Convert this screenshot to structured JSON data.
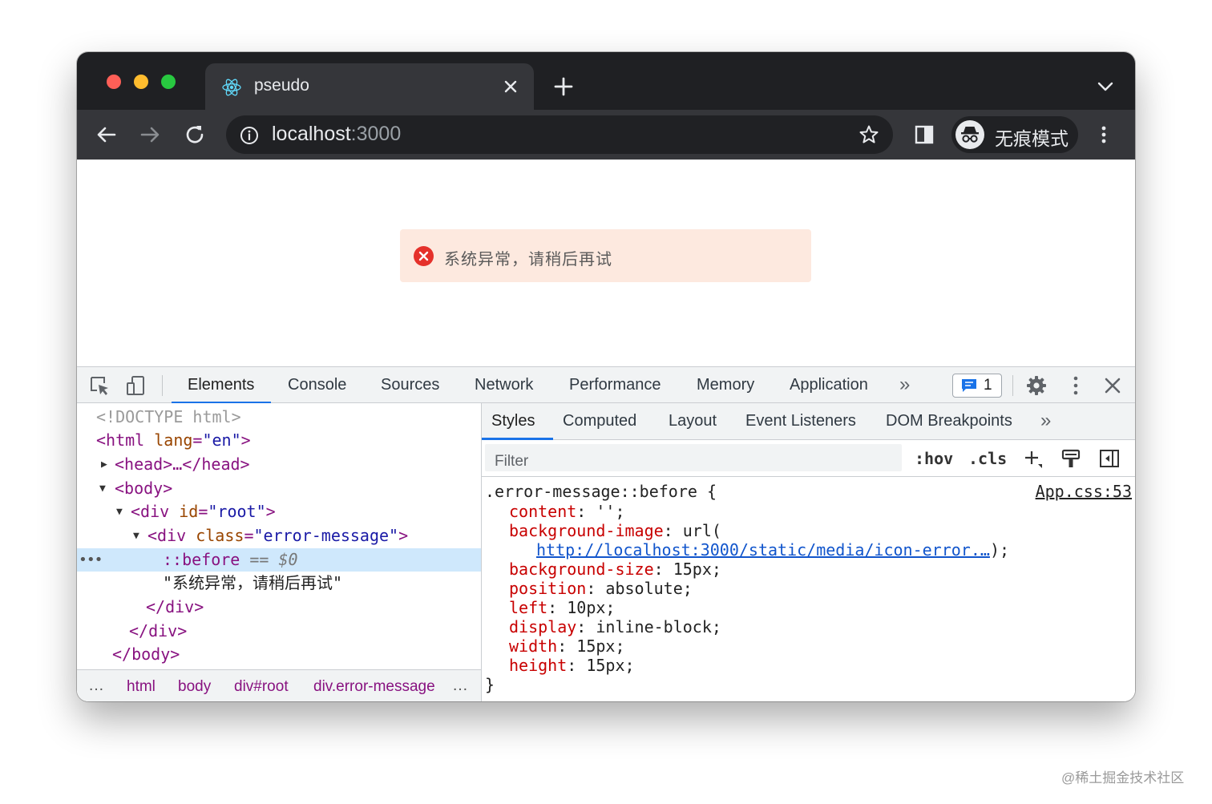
{
  "browser": {
    "tab_title": "pseudo",
    "url_host": "localhost",
    "url_port": ":3000",
    "incognito_label": "无痕模式"
  },
  "page": {
    "error_message": "系统异常，请稍后再试"
  },
  "devtools": {
    "tabs": [
      "Elements",
      "Console",
      "Sources",
      "Network",
      "Performance",
      "Memory",
      "Application"
    ],
    "more_tabs": "»",
    "issues_count": "1",
    "dom": {
      "doctype": "<!DOCTYPE html>",
      "html_open_tag": "<html ",
      "html_attr": "lang",
      "html_attr_val": "\"en\"",
      "html_open_close": ">",
      "head": "<head>…</head>",
      "body_open": "<body>",
      "div_open": "<div ",
      "root_attr": "id",
      "root_val": "\"root\"",
      "class_attr": "class",
      "class_val": "\"error-message\"",
      "gt": ">",
      "eq": "=",
      "pseudo": "::before",
      "pseudo_eq": " == ",
      "pseudo_ref": "$0",
      "text_node": "\"系统异常，请稍后再试\"",
      "div_close": "</div>",
      "body_close": "</body>",
      "gutter_dots": "•••"
    },
    "breadcrumbs": {
      "leading": "…",
      "items": [
        "html",
        "body",
        "div#root",
        "div.error-message"
      ],
      "trailing": "…"
    },
    "styles": {
      "tabs": [
        "Styles",
        "Computed",
        "Layout",
        "Event Listeners",
        "DOM Breakpoints"
      ],
      "more_tabs": "»",
      "filter_placeholder": "Filter",
      "hov": ":hov",
      "cls": ".cls",
      "selector": ".error-message::before {",
      "source": "App.css:53",
      "declarations": [
        {
          "prop": "content",
          "value": " '';"
        },
        {
          "prop": "background-image",
          "value": " url("
        },
        {
          "prop": "background-size",
          "value": " 15px;"
        },
        {
          "prop": "position",
          "value": " absolute;"
        },
        {
          "prop": "left",
          "value": " 10px;"
        },
        {
          "prop": "display",
          "value": " inline-block;"
        },
        {
          "prop": "width",
          "value": " 15px;"
        },
        {
          "prop": "height",
          "value": " 15px;"
        }
      ],
      "url_link": "http://localhost:3000/static/media/icon-error.…",
      "url_close": ");",
      "colon": ":",
      "closing_brace": "}"
    }
  },
  "watermark": "@稀土掘金技术社区",
  "colors": {
    "titlebar": "#1f2023",
    "toolbar": "#35363a",
    "error_bg": "#fde9df",
    "error_icon": "#e5312b",
    "accent": "#1a73e8"
  }
}
